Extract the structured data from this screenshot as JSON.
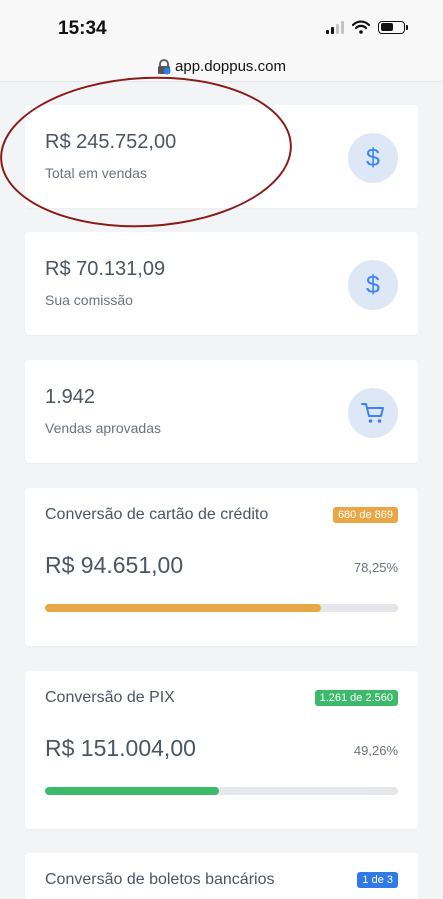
{
  "status_bar": {
    "time": "15:34"
  },
  "browser": {
    "url": "app.doppus.com"
  },
  "stats": [
    {
      "value": "R$ 245.752,00",
      "label": "Total em vendas",
      "icon": "dollar-icon"
    },
    {
      "value": "R$ 70.131,09",
      "label": "Sua comissão",
      "icon": "dollar-icon"
    },
    {
      "value": "1.942",
      "label": "Vendas aprovadas",
      "icon": "cart-icon"
    }
  ],
  "conversions": [
    {
      "title": "Conversão de cartão de crédito",
      "badge": "680 de 869",
      "amount": "R$ 94.651,00",
      "percent": "78,25%",
      "progress": 0.7825,
      "color": "#e8a644"
    },
    {
      "title": "Conversão de PIX",
      "badge": "1.261 de 2.560",
      "amount": "R$ 151.004,00",
      "percent": "49,26%",
      "progress": 0.4926,
      "color": "#3cba6a"
    },
    {
      "title": "Conversão de boletos bancários",
      "badge": "1 de 3",
      "color": "#2f7ae5"
    }
  ],
  "colors": {
    "accent": "#3b82f6",
    "annotation": "#8b1a1a"
  }
}
